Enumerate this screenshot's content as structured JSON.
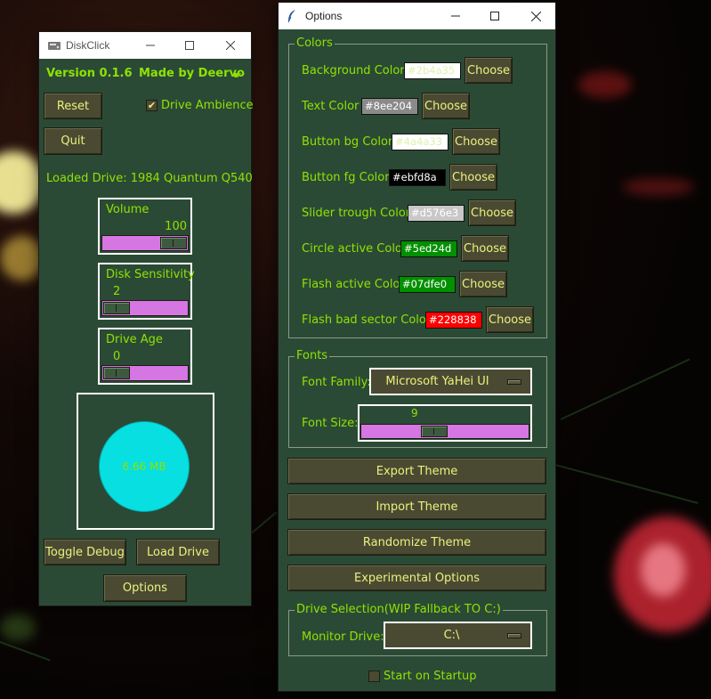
{
  "diskclick": {
    "title": "DiskClick",
    "version": "Version 0.1.6",
    "author": "Made by Deervo",
    "reset_label": "Reset",
    "quit_label": "Quit",
    "drive_ambience_label": "Drive Ambience",
    "drive_ambience_checked": "✔",
    "loaded_drive": "Loaded Drive: 1984 Quantum Q540",
    "volume": {
      "label": "Volume",
      "value": "100",
      "level": 1.0
    },
    "sensitivity": {
      "label": "Disk Sensitivity",
      "value": "2",
      "level": 0.0
    },
    "age": {
      "label": "Drive Age",
      "value": "0",
      "level": 0.0
    },
    "disk_size": "6.66 MB",
    "toggle_debug_label": "Toggle Debug",
    "load_drive_label": "Load Drive",
    "options_label": "Options"
  },
  "options": {
    "title": "Options",
    "colors_group": "Colors",
    "colors": [
      {
        "label": "Background Color",
        "value": "#2b4a35",
        "bg": "#ffffff",
        "fg": "#e0f0b0",
        "choose": "Choose"
      },
      {
        "label": "Text Color",
        "value": "#8ee204",
        "bg": "#8a8a8a",
        "fg": "#ffffff",
        "choose": "Choose"
      },
      {
        "label": "Button bg Color",
        "value": "#4a4a33",
        "bg": "#ffffff",
        "fg": "#e0f0b0",
        "choose": "Choose"
      },
      {
        "label": "Button fg Color",
        "value": "#ebfd8a",
        "bg": "#000000",
        "fg": "#ffffff",
        "choose": "Choose"
      },
      {
        "label": "Slider trough Color",
        "value": "#d576e3",
        "bg": "#c8c8c8",
        "fg": "#ffffff",
        "choose": "Choose"
      },
      {
        "label": "Circle active Color",
        "value": "#5ed24d",
        "bg": "#009000",
        "fg": "#ffffff",
        "choose": "Choose"
      },
      {
        "label": "Flash active Color",
        "value": "#07dfe0",
        "bg": "#009000",
        "fg": "#ffffff",
        "choose": "Choose"
      },
      {
        "label": "Flash bad sector Color",
        "value": "#228838",
        "bg": "#ff0000",
        "fg": "#ffffff",
        "choose": "Choose"
      }
    ],
    "fonts_group": "Fonts",
    "font_family_label": "Font Family:",
    "font_family_value": "Microsoft YaHei UI",
    "font_size_label": "Font Size:",
    "font_size_value": "9",
    "font_size_level": 0.42,
    "export_label": "Export Theme",
    "import_label": "Import Theme",
    "randomize_label": "Randomize Theme",
    "experimental_label": "Experimental Options",
    "drive_group": "Drive Selection(WIP Fallback TO C:)",
    "monitor_label": "Monitor Drive:",
    "monitor_value": "C:\\",
    "startup_label": "Start on Startup"
  },
  "colors": {
    "window_bg": "#2b4a35",
    "text": "#8ee204",
    "button_bg": "#4a4a33",
    "button_fg": "#ebfd8a",
    "trough": "#d576e3",
    "disk_circle": "#07dfe0"
  }
}
